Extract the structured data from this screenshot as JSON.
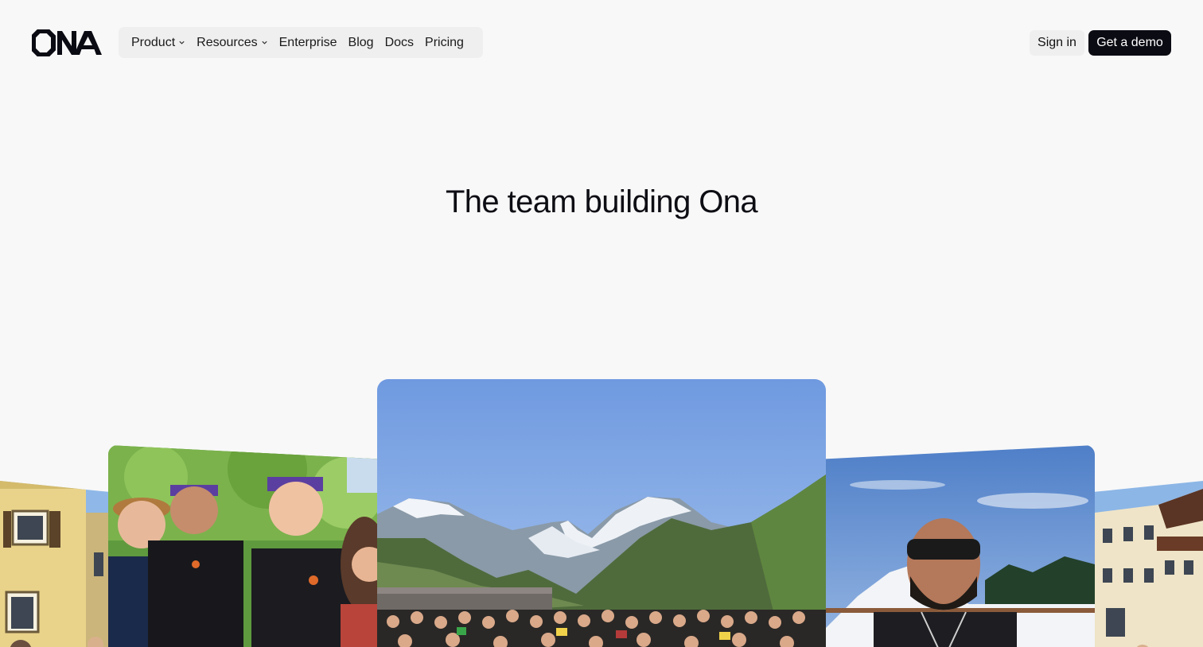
{
  "brand": {
    "logo_text": "ONA"
  },
  "nav": {
    "items": [
      {
        "label": "Product",
        "has_dropdown": true
      },
      {
        "label": "Resources",
        "has_dropdown": true
      },
      {
        "label": "Enterprise",
        "has_dropdown": false
      },
      {
        "label": "Blog",
        "has_dropdown": false
      },
      {
        "label": "Docs",
        "has_dropdown": false
      },
      {
        "label": "Pricing",
        "has_dropdown": false
      }
    ]
  },
  "auth": {
    "signin_label": "Sign in",
    "demo_label": "Get a demo"
  },
  "hero": {
    "title": "The team building Ona"
  },
  "gallery": {
    "photos": [
      {
        "icon": "building-photo"
      },
      {
        "icon": "team-selfie-photo"
      },
      {
        "icon": "mountain-group-photo"
      },
      {
        "icon": "ski-selfie-photo"
      },
      {
        "icon": "village-photo"
      }
    ]
  },
  "colors": {
    "page_bg": "#f8f8f8",
    "nav_bg": "#efefef",
    "primary": "#0b0b14"
  }
}
